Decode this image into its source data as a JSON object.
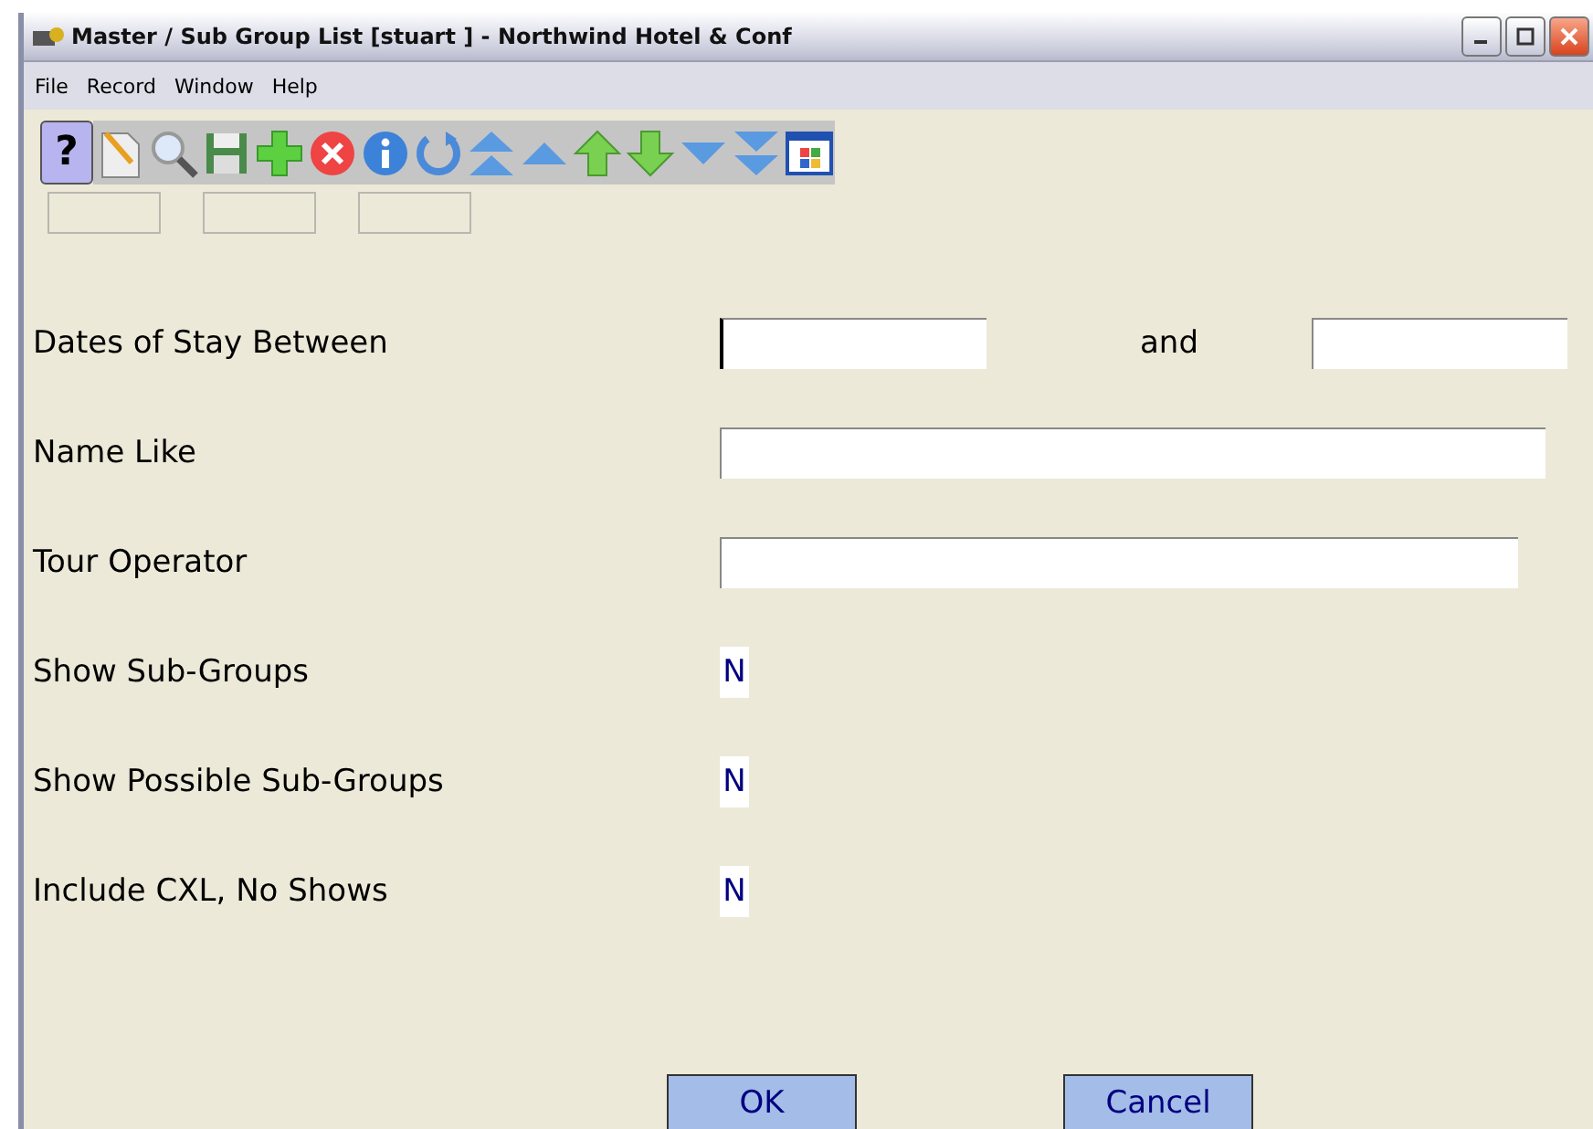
{
  "window": {
    "title": "Master / Sub Group List [stuart  ] - Northwind Hotel & Conf"
  },
  "menu": [
    "File",
    "Record",
    "Window",
    "Help"
  ],
  "toolbar": {
    "help_glyph": "?"
  },
  "dates": {
    "label": "Dates of Stay Between",
    "from": {
      "focused": true
    },
    "joiner": "and",
    "to": {
      "focused": false
    }
  },
  "text_fields": [
    {
      "label": "Name Like"
    },
    {
      "label": "Tour Operator"
    }
  ],
  "flags": [
    {
      "label": "Show Sub-Groups",
      "value": "N"
    },
    {
      "label": "Show Possible Sub-Groups",
      "value": "N"
    },
    {
      "label": "Include CXL, No Shows",
      "value": "N"
    }
  ],
  "buttons": [
    "OK",
    "Cancel"
  ]
}
